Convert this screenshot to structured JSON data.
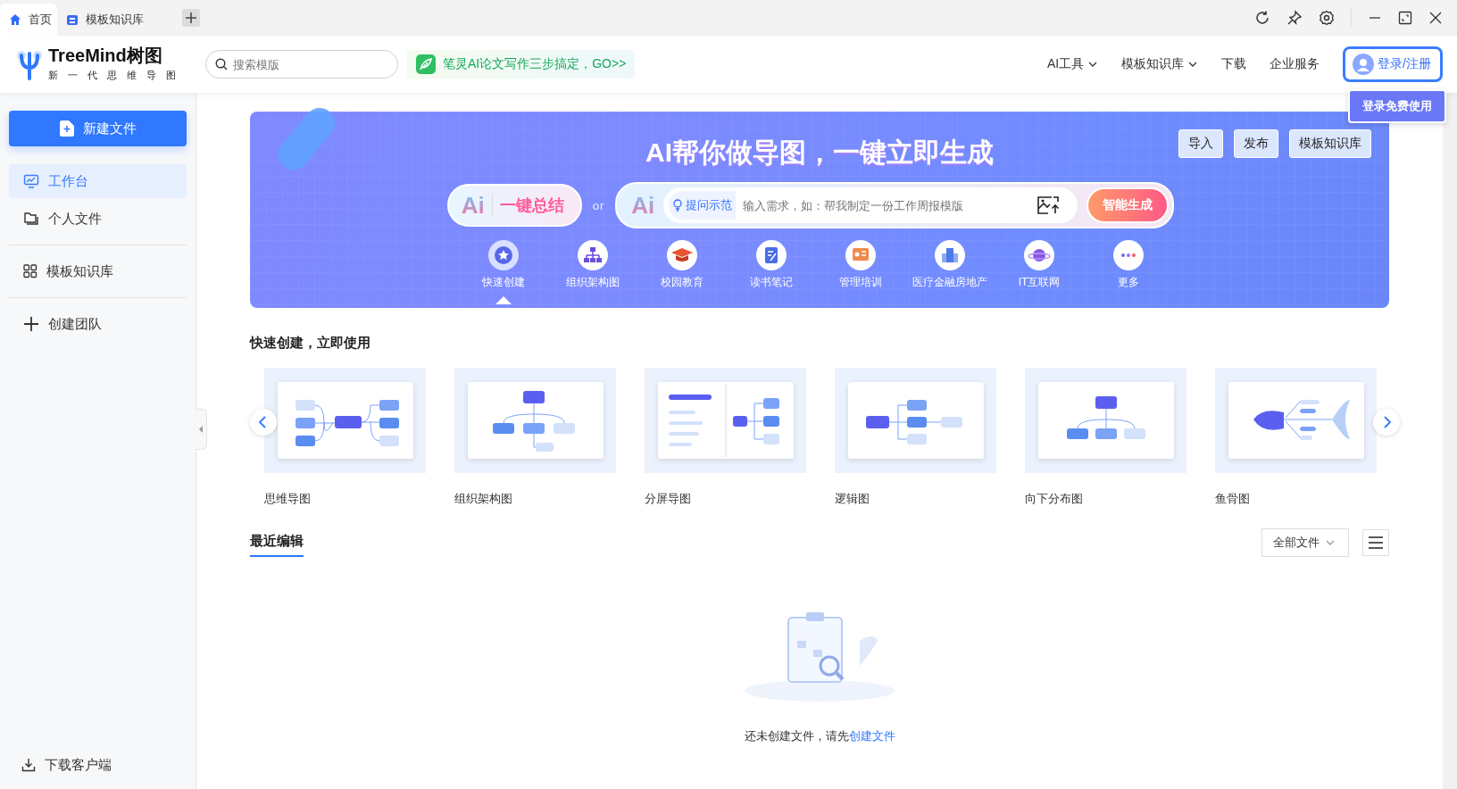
{
  "tabs": [
    {
      "label": "首页",
      "kind": "home",
      "selected": true
    },
    {
      "label": "模板知识库",
      "kind": "library",
      "selected": false
    }
  ],
  "header": {
    "brand": "TreeMind树图",
    "slogan": "新 一 代 思 维 导 图",
    "search": {
      "placeholder": "搜索模版"
    },
    "promo": "笔灵AI论文写作三步搞定，GO>>",
    "nav": [
      {
        "label": "AI工具",
        "dropdown": true
      },
      {
        "label": "模板知识库",
        "dropdown": true
      },
      {
        "label": "下载",
        "dropdown": false
      },
      {
        "label": "企业服务",
        "dropdown": false
      }
    ],
    "login": "登录/注册",
    "login_tip": "登录免费使用"
  },
  "sidebar": {
    "new_file": "新建文件",
    "groups": [
      [
        {
          "label": "工作台",
          "kind": "desk",
          "selected": true
        },
        {
          "label": "个人文件",
          "kind": "folder",
          "selected": false
        }
      ],
      [
        {
          "label": "模板知识库",
          "kind": "grid",
          "selected": false
        }
      ],
      [
        {
          "label": "创建团队",
          "kind": "plus",
          "selected": false
        }
      ]
    ],
    "download": "下载客户端"
  },
  "banner": {
    "title": "AI帮你做导图，一键立即生成",
    "buttons": [
      "导入",
      "发布",
      "模板知识库"
    ],
    "summary_logo": "Ai",
    "summary": "一键总结",
    "or": "or",
    "input_logo": "Ai",
    "example": "提问示范",
    "placeholder": "输入需求，如：帮我制定一份工作周报模版",
    "generate": "智能生成",
    "categories": [
      {
        "label": "快速创建",
        "selected": true
      },
      {
        "label": "组织架构图",
        "selected": false
      },
      {
        "label": "校园教育",
        "selected": false
      },
      {
        "label": "读书笔记",
        "selected": false
      },
      {
        "label": "管理培训",
        "selected": false
      },
      {
        "label": "医疗金融房地产",
        "selected": false
      },
      {
        "label": "IT互联网",
        "selected": false
      },
      {
        "label": "更多",
        "selected": false
      }
    ]
  },
  "quick": {
    "title": "快速创建，立即使用",
    "templates": [
      {
        "label": "思维导图",
        "kind": "mindmap"
      },
      {
        "label": "组织架构图",
        "kind": "org"
      },
      {
        "label": "分屏导图",
        "kind": "split"
      },
      {
        "label": "逻辑图",
        "kind": "logic"
      },
      {
        "label": "向下分布图",
        "kind": "tree"
      },
      {
        "label": "鱼骨图",
        "kind": "fishbone"
      }
    ]
  },
  "recent": {
    "tab": "最近编辑",
    "filter": "全部文件",
    "empty_text": "还未创建文件，请先",
    "empty_link": "创建文件"
  }
}
